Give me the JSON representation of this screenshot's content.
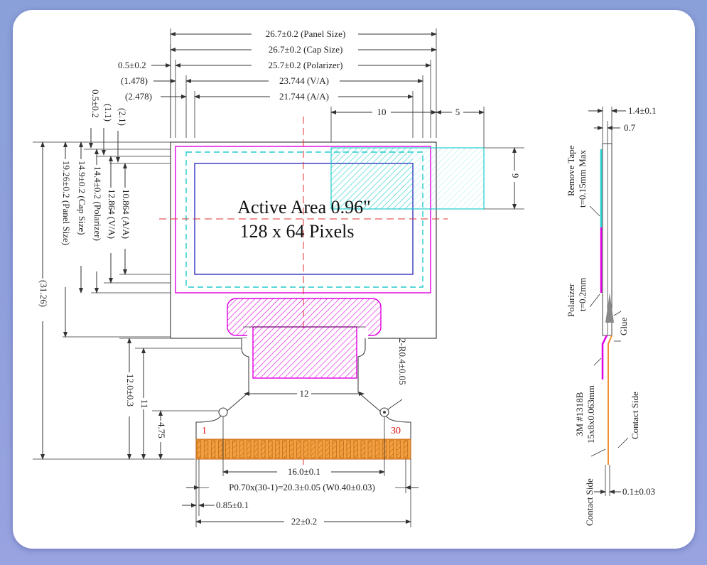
{
  "top_dims": {
    "panel_size": "26.7±0.2 (Panel Size)",
    "cap_size": "26.7±0.2 (Cap Size)",
    "polarizer_offset": "0.5±0.2",
    "polarizer": "25.7±0.2 (Polarizer)",
    "va_offset": "(1.478)",
    "va": "23.744 (V/A)",
    "aa_offset": "(2.478)",
    "aa": "21.744 (A/A)",
    "ten": "10",
    "five": "5"
  },
  "left_dims": {
    "pol_off_v": "0.5±0.2",
    "va_off_v": "(1.1)",
    "aa_off_v": "(2.1)",
    "aa_v": "10.864 (A/A)",
    "va_v": "12.864 (V/A)",
    "pol_v": "14.4±0.2 (Polarizer)",
    "cap_v": "14.9±0.2 (Cap Size)",
    "panel_v": "19.26±0.2 (Panel Size)",
    "total_v": "(31.26)",
    "fpc_v": "12.0±0.3",
    "eleven": "11",
    "pad_v": "4.75"
  },
  "active_area": {
    "line1": "Active Area 0.96\"",
    "line2": "128 x 64 Pixels"
  },
  "right_box": {
    "nine": "9"
  },
  "fpc": {
    "twelve": "12",
    "radius": "2-R0.4±0.05",
    "pin_first": "1",
    "pin_last": "30",
    "hole_pitch": "16.0±0.1",
    "pitch": "P0.70x(30-1)=20.3±0.05 (W0.40±0.03)",
    "edge": "0.85±0.1",
    "width": "22±0.2"
  },
  "side_view": {
    "t1": "1.4±0.1",
    "t2": "0.7",
    "remove_tape_1": "Remove Tape",
    "remove_tape_2": "t=0.15mm Max",
    "polarizer_1": "Polarizer",
    "polarizer_2": "t=0.2mm",
    "glue": "Glue",
    "tape_1": "3M #1318B",
    "tape_2": "15x8x0.063mm",
    "contact_1": "Contact Side",
    "contact_2": "Contact Side",
    "fpc_thk": "0.1±0.03"
  },
  "colors": {
    "magenta": "#e000e0",
    "cyan": "#22dddd",
    "blue": "#3030c0",
    "red_center": "#e03030",
    "orange": "#f09030"
  }
}
